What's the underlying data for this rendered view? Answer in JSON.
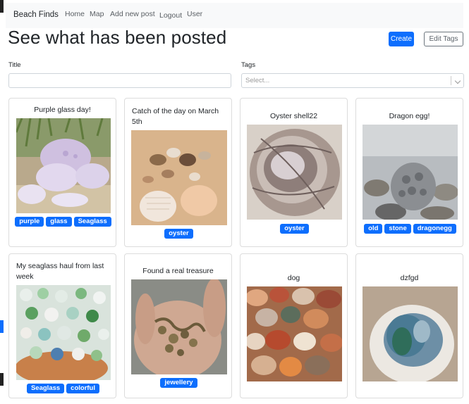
{
  "navbar": {
    "brand": "Beach Finds",
    "links": [
      "Home",
      "Map",
      "Add new post",
      "Logout",
      "User"
    ]
  },
  "page": {
    "title": "See what has been posted",
    "create_label": "Create",
    "edit_tags_label": "Edit Tags"
  },
  "filters": {
    "title_label": "Title",
    "title_value": "",
    "tags_label": "Tags",
    "tags_placeholder": "Select..."
  },
  "posts": [
    {
      "title": "Purple glass day!",
      "tags": [
        "purple",
        "glass",
        "Seaglass"
      ]
    },
    {
      "title": "Catch of the day on March 5th",
      "tags": [
        "oyster"
      ]
    },
    {
      "title": "Oyster shell22",
      "tags": [
        "oyster"
      ]
    },
    {
      "title": "Dragon egg!",
      "tags": [
        "old",
        "stone",
        "dragonegg"
      ]
    },
    {
      "title": "My seaglass haul from last week",
      "tags": [
        "Seaglass",
        "colorful"
      ]
    },
    {
      "title": "Found a real treasure",
      "tags": [
        "jewellery"
      ]
    },
    {
      "title": "dog",
      "tags": []
    },
    {
      "title": "dzfgd",
      "tags": []
    }
  ],
  "colors": {
    "primary": "#0d6efd",
    "navbar_bg": "#f8f9fa"
  }
}
